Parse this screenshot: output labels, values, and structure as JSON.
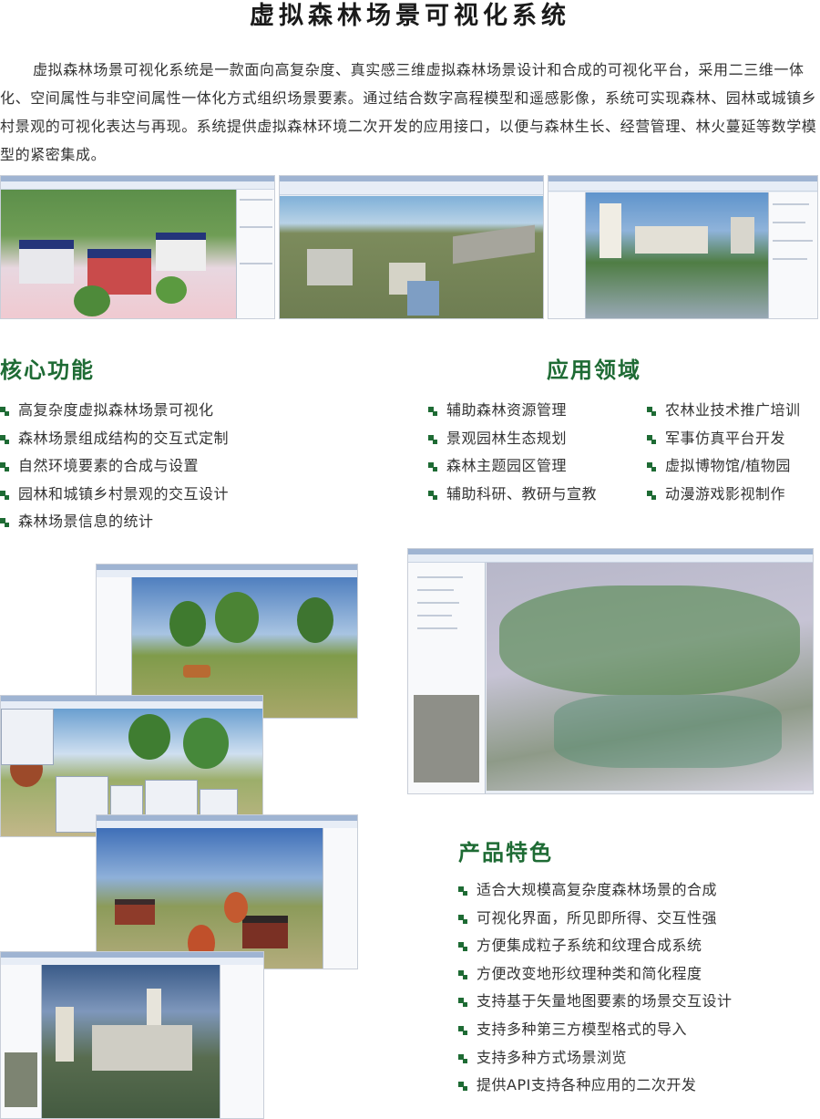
{
  "title": "虚拟森林场景可视化系统",
  "intro": "虚拟森林场景可视化系统是一款面向高复杂度、真实感三维虚拟森林场景设计和合成的可视化平台，采用二三维一体化、空间属性与非空间属性一体化方式组织场景要素。通过结合数字高程模型和遥感影像，系统可实现森林、园林或城镇乡村景观的可视化表达与再现。系统提供虚拟森林环境二次开发的应用接口，以便与森林生长、经营管理、林火蔓延等数学模型的紧密集成。",
  "sections": {
    "core": {
      "heading": "核心功能",
      "items": [
        "高复杂度虚拟森林场景可视化",
        "森林场景组成结构的交互式定制",
        "自然环境要素的合成与设置",
        "园林和城镇乡村景观的交互设计",
        "森林场景信息的统计"
      ]
    },
    "applications": {
      "heading": "应用领域",
      "col1": [
        "辅助森林资源管理",
        "景观园林生态规划",
        "森林主题园区管理",
        "辅助科研、教研与宣教"
      ],
      "col2": [
        "农林业技术推广培训",
        "军事仿真平台开发",
        "虚拟博物馆/植物园",
        "动漫游戏影视制作"
      ]
    },
    "features": {
      "heading": "产品特色",
      "items": [
        "适合大规模高复杂度森林场景的合成",
        "可视化界面，所见即所得、交互性强",
        "方便集成粒子系统和纹理合成系统",
        "方便改变地形纹理种类和简化程度",
        "支持基于矢量地图要素的场景交互设计",
        "支持多种第三方模型格式的导入",
        "支持多种方式场景浏览",
        "提供API支持各种应用的二次开发"
      ]
    }
  },
  "colors": {
    "accent": "#1e6b34",
    "bullet": "#1e6b34",
    "text": "#333333"
  },
  "icons": {
    "bullet": "green-square-bullet-icon"
  }
}
